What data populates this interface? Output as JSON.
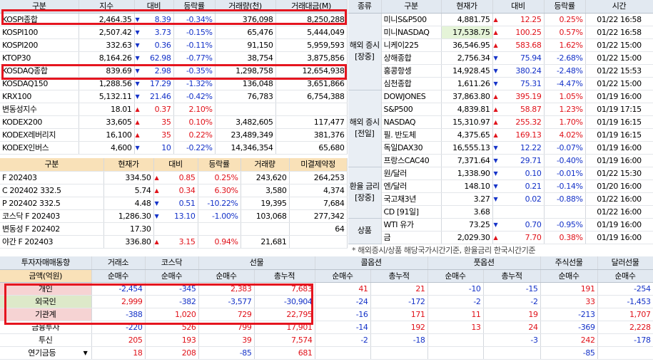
{
  "left_index_table": {
    "headers": [
      "구분",
      "지수",
      "대비",
      "등락률",
      "거래량(천)",
      "거래대금(M)"
    ],
    "rows": [
      {
        "name": "KOSPI종합",
        "price": "2,464.35",
        "dir": "dn",
        "diff": "8.39",
        "rate": "-0.34%",
        "vol": "376,098",
        "amt": "8,250,288"
      },
      {
        "name": "KOSPI100",
        "price": "2,507.42",
        "dir": "dn",
        "diff": "3.73",
        "rate": "-0.15%",
        "vol": "65,476",
        "amt": "5,444,049"
      },
      {
        "name": "KOSPI200",
        "price": "332.63",
        "dir": "dn",
        "diff": "0.36",
        "rate": "-0.11%",
        "vol": "91,150",
        "amt": "5,959,593"
      },
      {
        "name": "KTOP30",
        "price": "8,164.26",
        "dir": "dn",
        "diff": "62.98",
        "rate": "-0.77%",
        "vol": "38,754",
        "amt": "3,875,856"
      },
      {
        "name": "KOSDAQ종합",
        "price": "839.69",
        "dir": "dn",
        "diff": "2.98",
        "rate": "-0.35%",
        "vol": "1,298,758",
        "amt": "12,654,938"
      },
      {
        "name": "KOSDAQ150",
        "price": "1,288.56",
        "dir": "dn",
        "diff": "17.29",
        "rate": "-1.32%",
        "vol": "136,048",
        "amt": "3,651,866"
      },
      {
        "name": "KRX100",
        "price": "5,132.11",
        "dir": "dn",
        "diff": "21.46",
        "rate": "-0.42%",
        "vol": "76,783",
        "amt": "6,754,388"
      },
      {
        "name": "변동성지수",
        "price": "18.01",
        "dir": "up",
        "diff": "0.37",
        "rate": "2.10%",
        "vol": "",
        "amt": ""
      },
      {
        "name": "KODEX200",
        "price": "33,605",
        "dir": "up",
        "diff": "35",
        "rate": "0.10%",
        "vol": "3,482,605",
        "amt": "117,477"
      },
      {
        "name": "KODEX레버리지",
        "price": "16,100",
        "dir": "up",
        "diff": "35",
        "rate": "0.22%",
        "vol": "23,489,349",
        "amt": "381,376"
      },
      {
        "name": "KODEX인버스",
        "price": "4,600",
        "dir": "dn",
        "diff": "10",
        "rate": "-0.22%",
        "vol": "14,346,354",
        "amt": "65,680"
      }
    ]
  },
  "futures_table": {
    "headers": [
      "구분",
      "현재가",
      "대비",
      "등락률",
      "거래량",
      "미결제약정"
    ],
    "rows": [
      {
        "name": "F 202403",
        "price": "334.50",
        "dir": "up",
        "diff": "0.85",
        "rate": "0.25%",
        "vol": "243,620",
        "oi": "264,253"
      },
      {
        "name": "C 202402 332.5",
        "price": "5.74",
        "dir": "up",
        "diff": "0.34",
        "rate": "6.30%",
        "vol": "3,580",
        "oi": "4,374"
      },
      {
        "name": "P 202402 332.5",
        "price": "4.48",
        "dir": "dn",
        "diff": "0.51",
        "rate": "-10.22%",
        "vol": "19,395",
        "oi": "7,684"
      },
      {
        "name": "코스닥 F 202403",
        "price": "1,286.30",
        "dir": "dn",
        "diff": "13.10",
        "rate": "-1.00%",
        "vol": "103,068",
        "oi": "277,342"
      },
      {
        "name": "변동성 F 202402",
        "price": "17.30",
        "dir": "",
        "diff": "",
        "rate": "",
        "vol": "",
        "oi": "64"
      },
      {
        "name": "야간 F 202403",
        "price": "336.80",
        "dir": "up",
        "diff": "3.15",
        "rate": "0.94%",
        "vol": "21,681",
        "oi": ""
      }
    ]
  },
  "world_table": {
    "headers": [
      "종류",
      "구분",
      "현재가",
      "대비",
      "등락률",
      "시간"
    ],
    "groups": [
      {
        "label": "해외 증시 [장중]",
        "rows": [
          {
            "name": "미니S&P500",
            "price": "4,881.75",
            "dir": "up",
            "diff": "12.25",
            "rate": "0.25%",
            "time": "01/22 16:58"
          },
          {
            "name": "미니NASDAQ",
            "price": "17,538.75",
            "dir": "up",
            "diff": "100.25",
            "rate": "0.57%",
            "time": "01/22 16:58"
          },
          {
            "name": "니케이225",
            "price": "36,546.95",
            "dir": "up",
            "diff": "583.68",
            "rate": "1.62%",
            "time": "01/22 15:00"
          },
          {
            "name": "상해종합",
            "price": "2,756.34",
            "dir": "dn",
            "diff": "75.94",
            "rate": "-2.68%",
            "time": "01/22 15:00"
          },
          {
            "name": "홍콩항셍",
            "price": "14,928.45",
            "dir": "dn",
            "diff": "380.24",
            "rate": "-2.48%",
            "time": "01/22 15:53"
          },
          {
            "name": "심천종합",
            "price": "1,611.26",
            "dir": "dn",
            "diff": "75.31",
            "rate": "-4.47%",
            "time": "01/22 15:00"
          }
        ]
      },
      {
        "label": "해외 증시 [전일]",
        "rows": [
          {
            "name": "DOWJONES",
            "price": "37,863.80",
            "dir": "up",
            "diff": "395.19",
            "rate": "1.05%",
            "time": "01/19 16:00"
          },
          {
            "name": "S&P500",
            "price": "4,839.81",
            "dir": "up",
            "diff": "58.87",
            "rate": "1.23%",
            "time": "01/19 17:15"
          },
          {
            "name": "NASDAQ",
            "price": "15,310.97",
            "dir": "up",
            "diff": "255.32",
            "rate": "1.70%",
            "time": "01/19 16:15"
          },
          {
            "name": "필. 반도체",
            "price": "4,375.65",
            "dir": "up",
            "diff": "169.13",
            "rate": "4.02%",
            "time": "01/19 16:15"
          },
          {
            "name": "독일DAX30",
            "price": "16,555.13",
            "dir": "dn",
            "diff": "12.22",
            "rate": "-0.07%",
            "time": "01/19 16:00"
          },
          {
            "name": "프랑스CAC40",
            "price": "7,371.64",
            "dir": "dn",
            "diff": "29.71",
            "rate": "-0.40%",
            "time": "01/19 16:00"
          }
        ]
      },
      {
        "label": "환율 금리 [장중]",
        "rows": [
          {
            "name": "원/달러",
            "price": "1,338.90",
            "dir": "dn",
            "diff": "0.10",
            "rate": "-0.01%",
            "time": "01/22 15:30"
          },
          {
            "name": "엔/달러",
            "price": "148.10",
            "dir": "dn",
            "diff": "0.21",
            "rate": "-0.14%",
            "time": "01/20 16:00"
          },
          {
            "name": "국고채3년",
            "price": "3.27",
            "dir": "dn",
            "diff": "0.02",
            "rate": "-0.88%",
            "time": "01/22 16:00"
          },
          {
            "name": "CD [91일]",
            "price": "3.68",
            "dir": "",
            "diff": "",
            "rate": "",
            "time": "01/22 16:00"
          }
        ]
      },
      {
        "label": "상품",
        "rows": [
          {
            "name": "WTI 유가",
            "price": "73.25",
            "dir": "dn",
            "diff": "0.70",
            "rate": "-0.95%",
            "time": "01/19 16:00"
          },
          {
            "name": "금",
            "price": "2,029.30",
            "dir": "up",
            "diff": "7.70",
            "rate": "0.38%",
            "time": "01/19 16:00"
          }
        ]
      }
    ],
    "footnote": "* 해외증시/상품 해당국가시간기준, 환율금리 한국시간기준"
  },
  "investor_table": {
    "title": "투자자매매동향",
    "unit_label": "금액(억원)",
    "top_headers": [
      "거래소",
      "코스닥",
      "선물",
      "콜옵션",
      "풋옵션",
      "주식선물",
      "달러선물"
    ],
    "sub_headers": [
      "순매수",
      "순매수",
      "순매수",
      "총누적",
      "순매수",
      "총누적",
      "순매수",
      "총누적",
      "순매수",
      "순매수"
    ],
    "rows": [
      {
        "name": "개인",
        "vals": [
          "-2,454",
          "-345",
          "2,383",
          "7,683",
          "41",
          "21",
          "-10",
          "-15",
          "191",
          "-254"
        ]
      },
      {
        "name": "외국인",
        "vals": [
          "2,999",
          "-382",
          "-3,577",
          "-30,904",
          "-24",
          "-172",
          "-2",
          "-2",
          "33",
          "-1,453"
        ]
      },
      {
        "name": "기관계",
        "vals": [
          "-388",
          "1,020",
          "729",
          "22,795",
          "-16",
          "171",
          "11",
          "19",
          "-213",
          "1,707"
        ]
      },
      {
        "name": "금융투자",
        "vals": [
          "-220",
          "526",
          "799",
          "17,901",
          "-14",
          "192",
          "13",
          "24",
          "-369",
          "2,228"
        ]
      },
      {
        "name": "투신",
        "vals": [
          "205",
          "193",
          "39",
          "7,574",
          "-2",
          "-18",
          "",
          "-3",
          "242",
          "-178"
        ]
      },
      {
        "name": "연기금등",
        "vals": [
          "18",
          "208",
          "-85",
          "681",
          "",
          "",
          "",
          "",
          "-85",
          ""
        ]
      }
    ]
  },
  "colors": {
    "up": "#e0121a",
    "down": "#1432c8",
    "highlight_box": "#e5151f",
    "orange_header": "#f9e1b8",
    "label_pink": "#f6d3d3",
    "label_green": "#dde9c9"
  }
}
